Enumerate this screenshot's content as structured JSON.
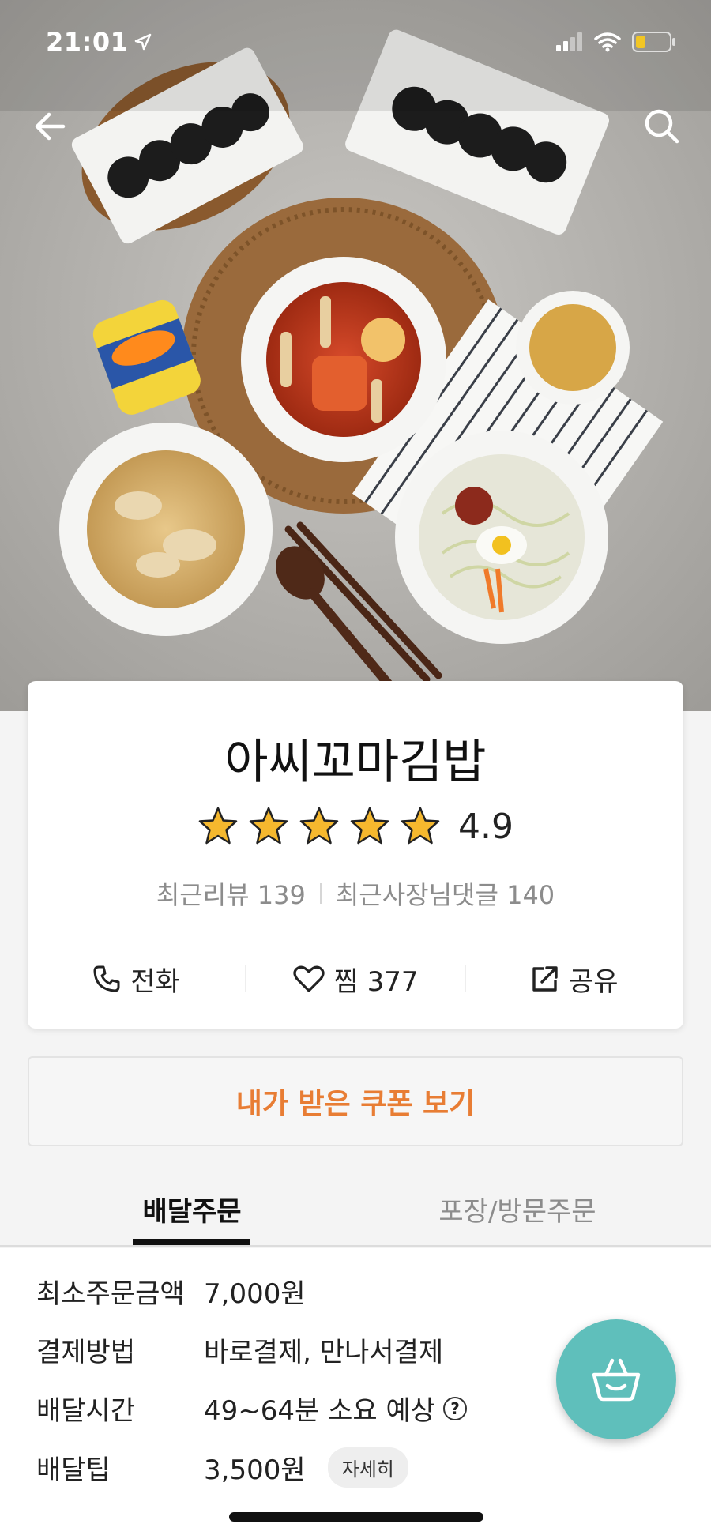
{
  "status_bar": {
    "time": "21:01"
  },
  "store": {
    "name": "아씨꼬마김밥",
    "rating": "4.9",
    "rating_stars": 5,
    "recent_reviews": "최근리뷰 139",
    "recent_owner_replies": "최근사장님댓글 140"
  },
  "actions": {
    "call": "전화",
    "favorite": "찜 377",
    "share": "공유"
  },
  "coupon_button": "내가 받은 쿠폰 보기",
  "tabs": {
    "delivery": "배달주문",
    "pickup": "포장/방문주문"
  },
  "details": [
    {
      "label": "최소주문금액",
      "value": "7,000원"
    },
    {
      "label": "결제방법",
      "value": "바로결제, 만나서결제"
    },
    {
      "label": "배달시간",
      "value": "49~64분 소요 예상"
    },
    {
      "label": "배달팁",
      "value": "3,500원",
      "button": "자세히"
    }
  ],
  "help_symbol": "?",
  "colors": {
    "accent": "#e87d34",
    "fab": "#5fbfbb",
    "star": "#f5b82e"
  }
}
